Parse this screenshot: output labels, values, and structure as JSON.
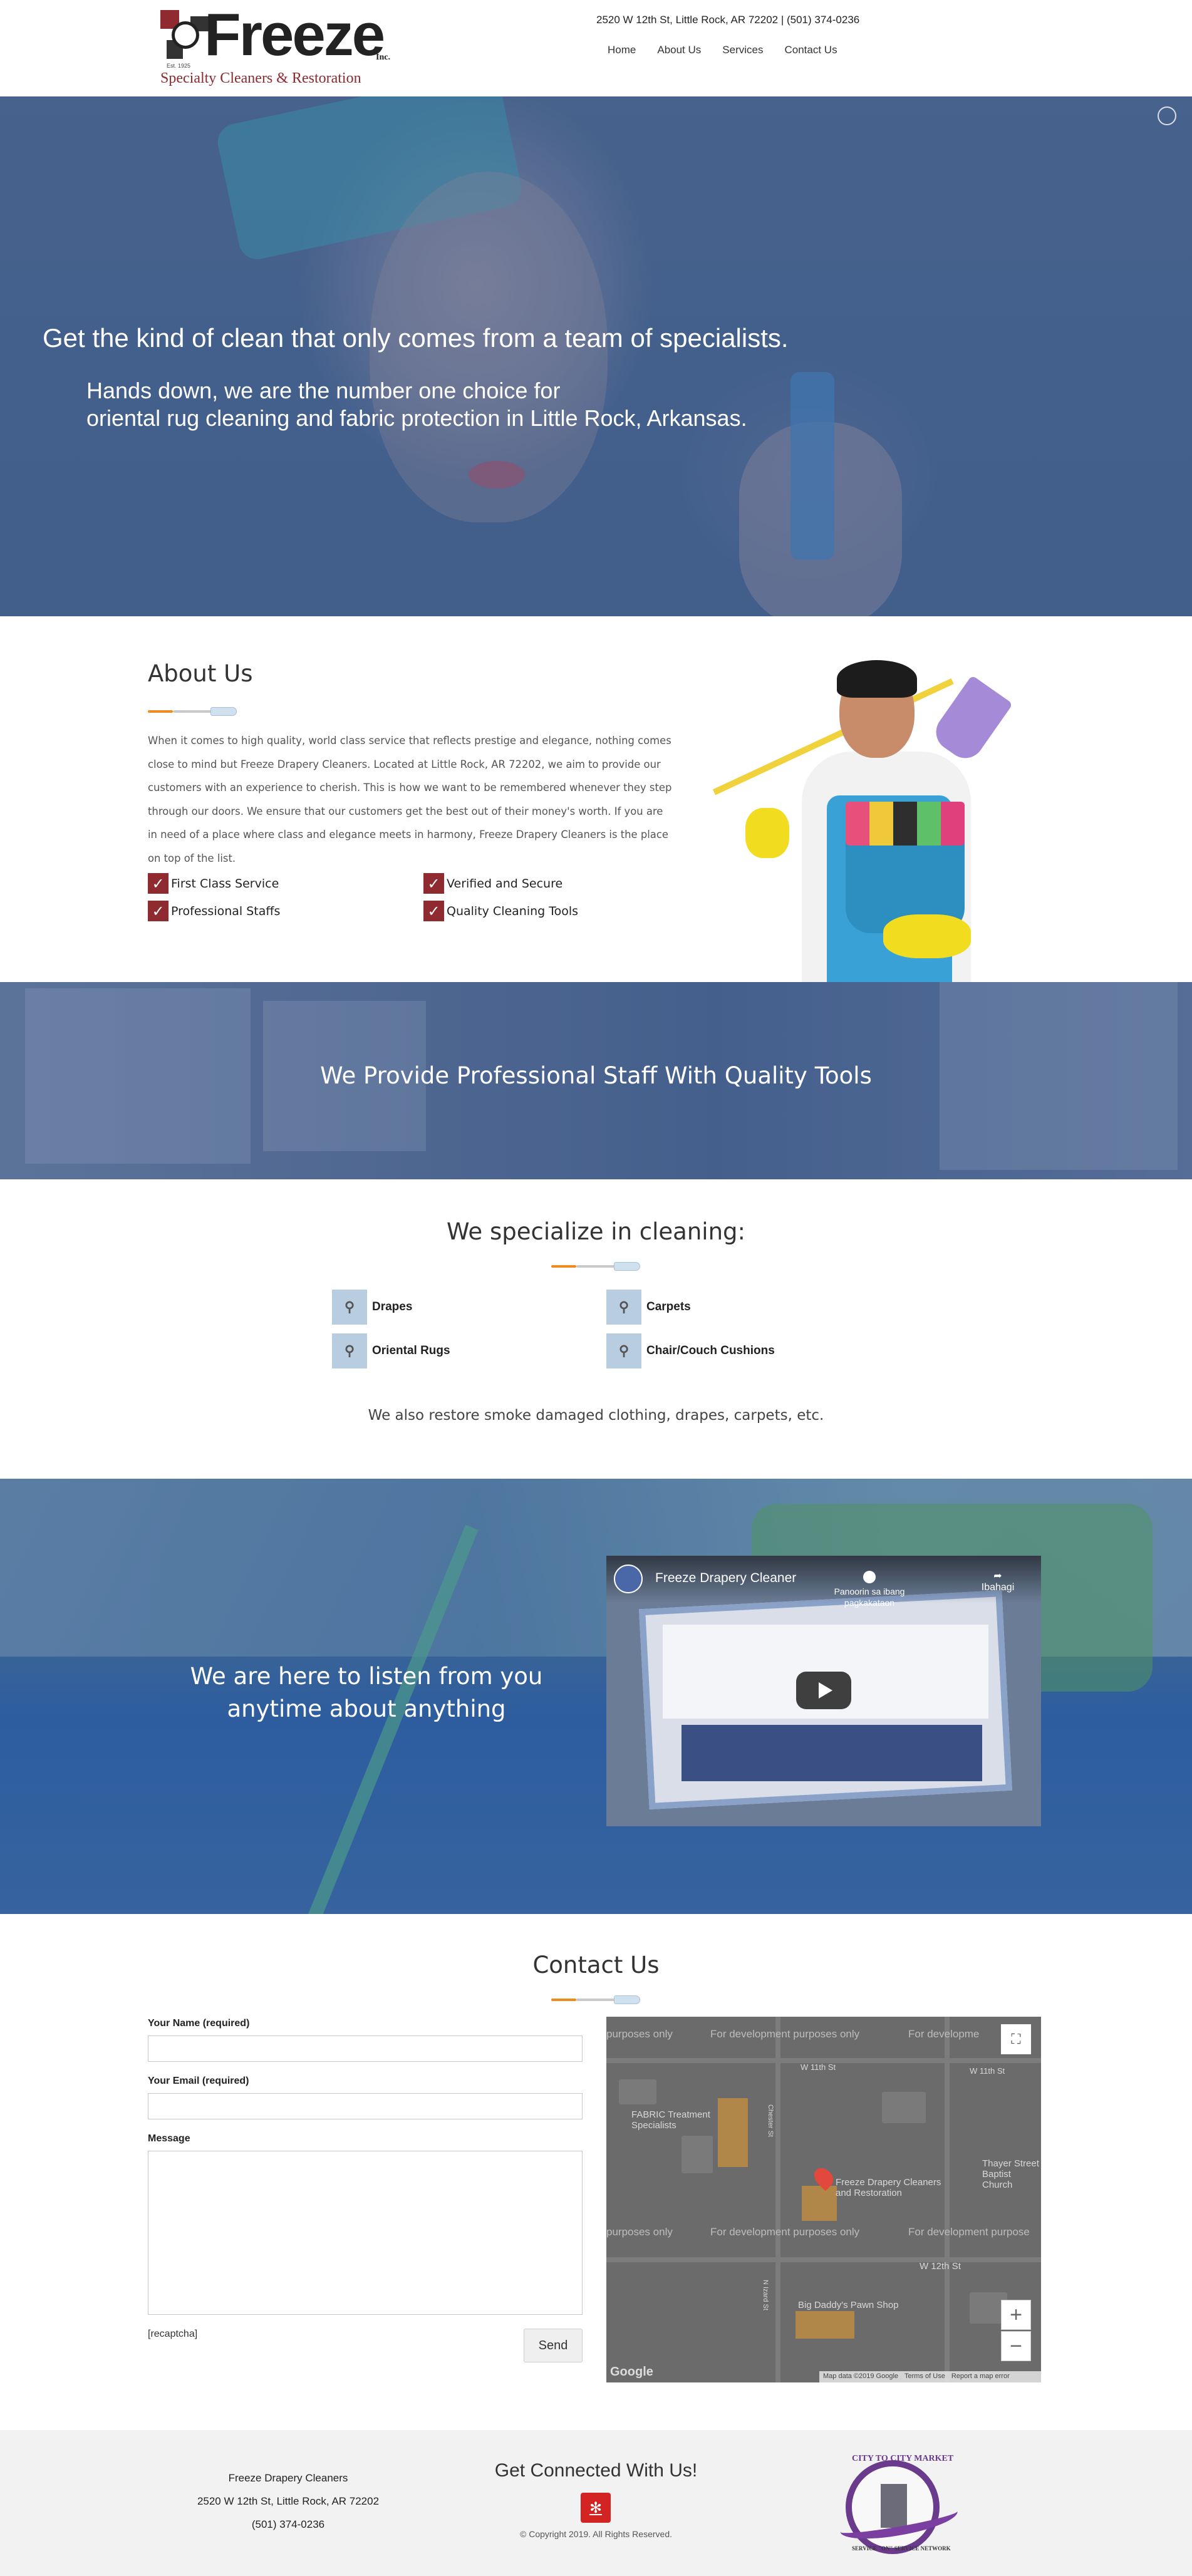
{
  "header": {
    "brand": "Freeze",
    "brand_suffix": "Inc.",
    "est": "Est. 1925",
    "tagline": "Specialty Cleaners & Restoration",
    "contact_line": "2520 W 12th St, Little Rock, AR 72202 | (501) 374-0236",
    "nav": [
      "Home",
      "About Us",
      "Services",
      "Contact Us"
    ]
  },
  "hero": {
    "headline": "Get the kind of clean that only comes from a team of specialists.",
    "sub_line1": "Hands down, we are the number one choice for",
    "sub_line2": "oriental rug cleaning and fabric protection in Little Rock, Arkansas."
  },
  "about": {
    "title": "About Us",
    "body": "When it comes to high quality, world class service that reflects prestige and elegance, nothing comes close to mind but Freeze Drapery Cleaners. Located at Little Rock, AR 72202, we aim to provide our customers with an experience to cherish. This is how we want to be remembered whenever they step through our doors. We ensure that our customers get the best out of their money's worth. If you are in need of a place where class and elegance meets in harmony, Freeze Drapery Cleaners is the place on top of the list.",
    "features": [
      "First Class Service",
      "Verified and Secure",
      "Professional Staffs",
      "Quality Cleaning Tools"
    ]
  },
  "banner": {
    "text": "We Provide Professional Staff With Quality Tools"
  },
  "specialize": {
    "title": "We specialize in cleaning:",
    "services": [
      "Drapes",
      "Carpets",
      "Oriental Rugs",
      "Chair/Couch Cushions"
    ],
    "note": "We also restore smoke damaged clothing, drapes, carpets, etc."
  },
  "listen": {
    "text": "We are here to listen from you anytime about anything",
    "video": {
      "title": "Freeze Drapery Cleaner",
      "watch_later": "Panoorin sa ibang pagkakataon",
      "share": "Ibahagi"
    }
  },
  "contact": {
    "title": "Contact Us",
    "name_label": "Your Name (required)",
    "email_label": "Your Email (required)",
    "message_label": "Message",
    "recaptcha": "[recaptcha]",
    "send_label": "Send",
    "map": {
      "dev_text": "For development purposes only",
      "dev_text_short": "purposes only",
      "dev_text_left": "For developme",
      "dev_text_right": "For development purpose",
      "street_top": "W 11th St",
      "street_top_right": "W 11th St",
      "street_bottom": "W 12th St",
      "street_vertical1": "Chester St",
      "street_vertical2": "N Izard St",
      "poi1": "FABRIC Treatment Specialists",
      "poi2": "Freeze Drapery Cleaners and Restoration",
      "poi3": "Big Daddy's Pawn Shop",
      "poi4": "Thayer Street Baptist Church",
      "zoom_in": "+",
      "zoom_out": "−",
      "logo": "Google",
      "attrib": [
        "Map data ©2019 Google",
        "Terms of Use",
        "Report a map error"
      ]
    }
  },
  "footer": {
    "company": "Freeze Drapery Cleaners",
    "address": "2520 W 12th St, Little Rock, AR 72202",
    "phone": "(501) 374-0236",
    "connect_title": "Get Connected With Us!",
    "copyright": "© Copyright 2019. All Rights Reserved.",
    "badge_top": "CITY TO CITY MARKET",
    "badge_bottom": "SERVICE \"ON\" SERVICE NETWORK"
  },
  "colors": {
    "brand_red": "#8e2a30",
    "accent_orange": "#f08a1c",
    "hero_overlay": "#4a6590"
  }
}
